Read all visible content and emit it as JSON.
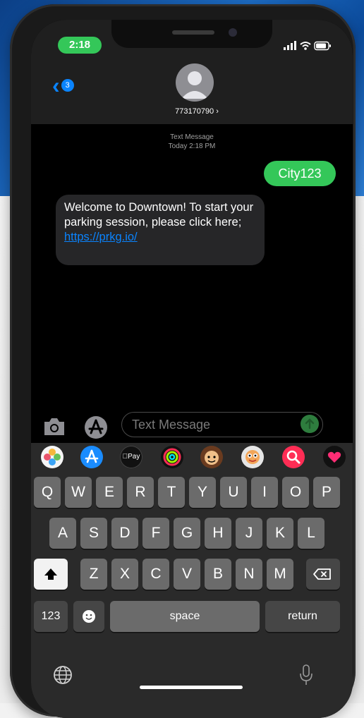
{
  "status": {
    "time": "2:18"
  },
  "header": {
    "back_badge": "3",
    "contact_number": "773170790 ›"
  },
  "thread": {
    "meta_type": "Text Message",
    "meta_time": "Today 2:18 PM",
    "sent_message": "City123",
    "received_text": "Welcome to Downtown!   To start your parking session, please click here;",
    "received_link": "https://prkg.io/"
  },
  "compose": {
    "placeholder": "Text Message"
  },
  "app_strip": {
    "apps": [
      "photos-icon",
      "app-store-icon",
      "apple-pay-icon",
      "activity-icon",
      "memoji-icon",
      "memoji-stickers-icon",
      "search-images-icon",
      "digital-touch-icon"
    ],
    "apple_pay_label": "Pay"
  },
  "keyboard": {
    "row1": [
      "Q",
      "W",
      "E",
      "R",
      "T",
      "Y",
      "U",
      "I",
      "O",
      "P"
    ],
    "row2": [
      "A",
      "S",
      "D",
      "F",
      "G",
      "H",
      "J",
      "K",
      "L"
    ],
    "row3": [
      "Z",
      "X",
      "C",
      "V",
      "B",
      "N",
      "M"
    ],
    "numbers_key": "123",
    "space_key": "space",
    "return_key": "return"
  },
  "colors": {
    "ios_blue": "#0a84ff",
    "imessage_green": "#34c759",
    "keyboard_bg": "#2a2a2a"
  }
}
